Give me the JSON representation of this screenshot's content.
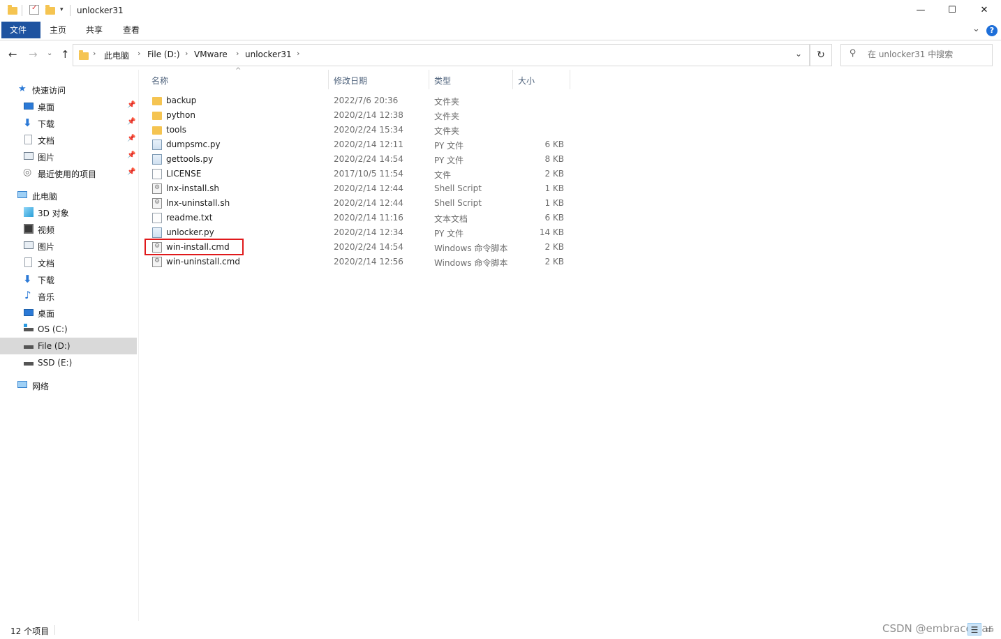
{
  "window": {
    "title": "unlocker31",
    "minimize": "—",
    "maximize": "☐",
    "close": "✕"
  },
  "ribbon": {
    "tabs": [
      "文件",
      "主页",
      "共享",
      "查看"
    ],
    "expand": "⌄",
    "help": "?"
  },
  "nav": {
    "back": "←",
    "forward": "→",
    "recent": "⌄",
    "up": "↑",
    "breadcrumb": [
      "此电脑",
      "File (D:)",
      "VMware",
      "unlocker31"
    ],
    "dropdown": "⌄",
    "refresh": "↻"
  },
  "search": {
    "placeholder": "在 unlocker31 中搜索"
  },
  "sidebar": {
    "quick_access": "快速访问",
    "quick_items": [
      "桌面",
      "下载",
      "文档",
      "图片",
      "最近使用的项目"
    ],
    "this_pc": "此电脑",
    "pc_items": [
      "3D 对象",
      "视频",
      "图片",
      "文档",
      "下载",
      "音乐",
      "桌面",
      "OS (C:)",
      "File (D:)",
      "SSD (E:)"
    ],
    "network": "网络",
    "selected": "File (D:)"
  },
  "columns": [
    "名称",
    "修改日期",
    "类型",
    "大小"
  ],
  "files": [
    {
      "name": "backup",
      "date": "2022/7/6 20:36",
      "type": "文件夹",
      "size": "",
      "icon": "folder-icon"
    },
    {
      "name": "python",
      "date": "2020/2/14 12:38",
      "type": "文件夹",
      "size": "",
      "icon": "folder-icon"
    },
    {
      "name": "tools",
      "date": "2020/2/24 15:34",
      "type": "文件夹",
      "size": "",
      "icon": "folder-icon"
    },
    {
      "name": "dumpsmc.py",
      "date": "2020/2/14 12:11",
      "type": "PY 文件",
      "size": "6 KB",
      "icon": "python-file-icon"
    },
    {
      "name": "gettools.py",
      "date": "2020/2/24 14:54",
      "type": "PY 文件",
      "size": "8 KB",
      "icon": "python-file-icon"
    },
    {
      "name": "LICENSE",
      "date": "2017/10/5 11:54",
      "type": "文件",
      "size": "2 KB",
      "icon": "file-icon"
    },
    {
      "name": "lnx-install.sh",
      "date": "2020/2/14 12:44",
      "type": "Shell Script",
      "size": "1 KB",
      "icon": "script-file-icon"
    },
    {
      "name": "lnx-uninstall.sh",
      "date": "2020/2/14 12:44",
      "type": "Shell Script",
      "size": "1 KB",
      "icon": "script-file-icon"
    },
    {
      "name": "readme.txt",
      "date": "2020/2/14 11:16",
      "type": "文本文档",
      "size": "6 KB",
      "icon": "text-file-icon"
    },
    {
      "name": "unlocker.py",
      "date": "2020/2/14 12:34",
      "type": "PY 文件",
      "size": "14 KB",
      "icon": "python-file-icon"
    },
    {
      "name": "win-install.cmd",
      "date": "2020/2/24 14:54",
      "type": "Windows 命令脚本",
      "size": "2 KB",
      "icon": "script-file-icon"
    },
    {
      "name": "win-uninstall.cmd",
      "date": "2020/2/14 12:56",
      "type": "Windows 命令脚本",
      "size": "2 KB",
      "icon": "script-file-icon"
    }
  ],
  "highlighted_file": "win-install.cmd",
  "status": {
    "count": "12 个项目"
  },
  "watermark": "CSDN @embracestar",
  "colors": {
    "file_tab": "#1e53a0",
    "highlight": "#e0191b",
    "folder": "#f5c451",
    "help": "#1e6fd9"
  }
}
